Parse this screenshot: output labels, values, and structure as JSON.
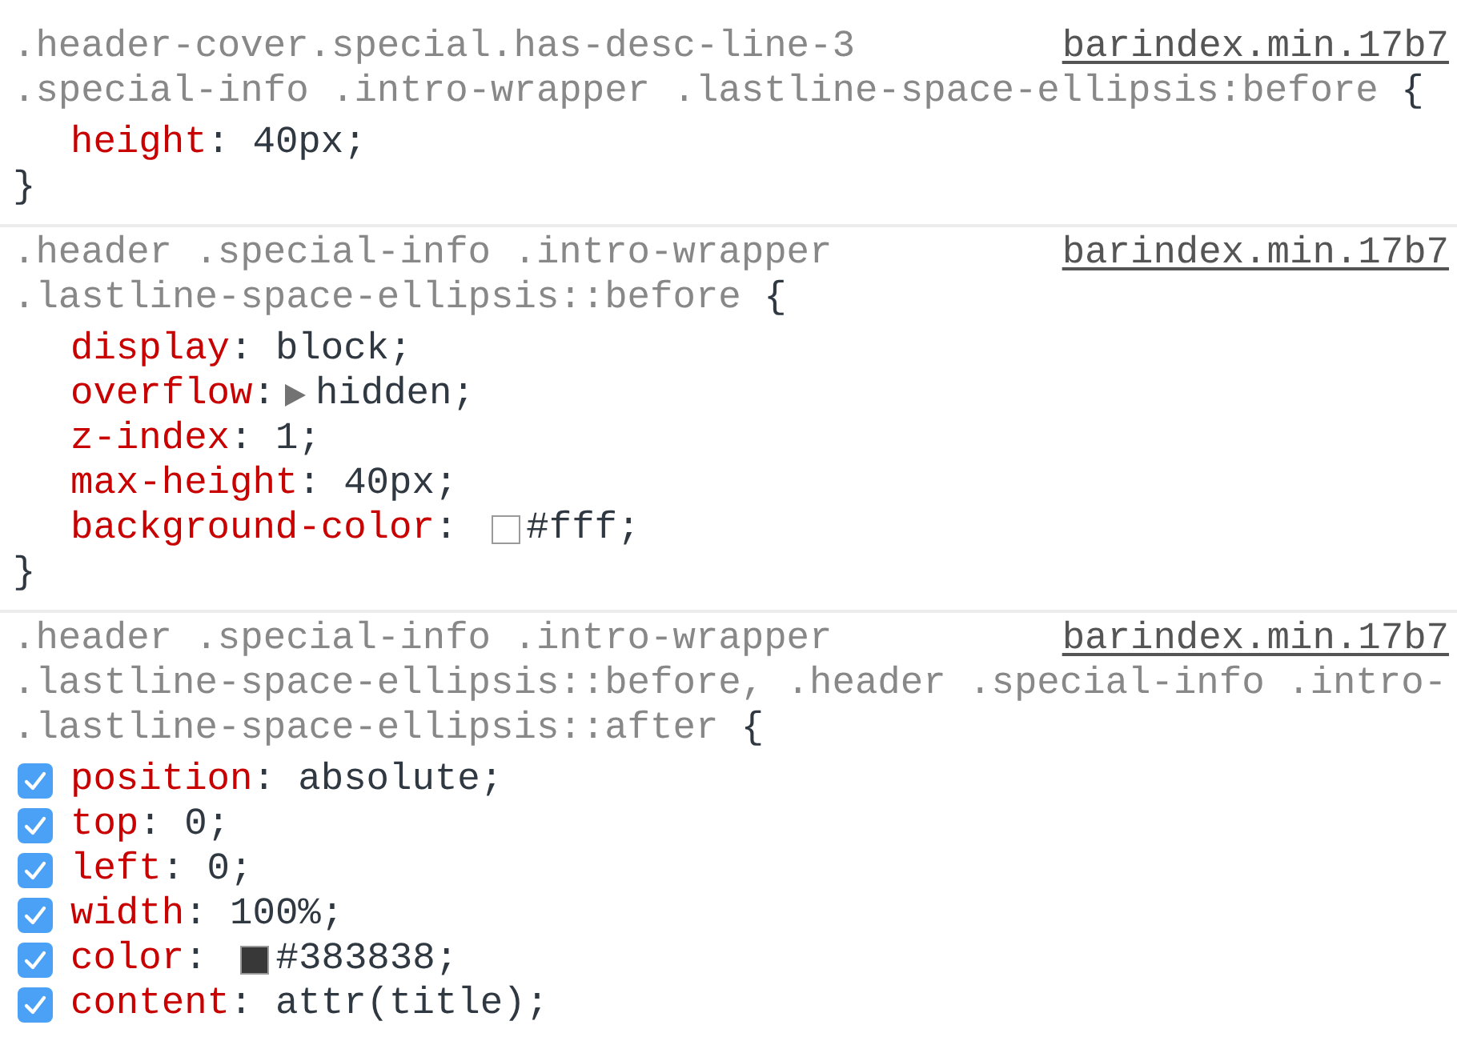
{
  "rules": [
    {
      "selector_lines": [
        {
          "text": ".header-cover.special.has-desc-line-3"
        },
        {
          "text": ".special-info .intro-wrapper .lastline-space-ellipsis:before",
          "brace": "{"
        }
      ],
      "source": "barindex.min.17b7",
      "declarations": [
        {
          "name": "height",
          "colon": ":",
          "expandable": false,
          "value": "40px;"
        }
      ],
      "close_brace": "}"
    },
    {
      "selector_lines": [
        {
          "text": ".header .special-info .intro-wrapper"
        },
        {
          "text": ".lastline-space-ellipsis::before",
          "brace": "{"
        }
      ],
      "source": "barindex.min.17b7",
      "declarations": [
        {
          "name": "display",
          "colon": ":",
          "expandable": false,
          "value": "block;"
        },
        {
          "name": "overflow",
          "colon": ":",
          "expandable": true,
          "value": "hidden;"
        },
        {
          "name": "z-index",
          "colon": ":",
          "expandable": false,
          "value": "1;"
        },
        {
          "name": "max-height",
          "colon": ":",
          "expandable": false,
          "value": "40px;"
        },
        {
          "name": "background-color",
          "colon": ":",
          "expandable": false,
          "color": "#ffffff",
          "value": "#fff;"
        }
      ],
      "close_brace": "}"
    },
    {
      "selector_lines": [
        {
          "text": ".header .special-info .intro-wrapper"
        },
        {
          "text": ".lastline-space-ellipsis::before, .header .special-info .intro-"
        },
        {
          "text": ".lastline-space-ellipsis::after",
          "brace": "{"
        }
      ],
      "source": "barindex.min.17b7",
      "declarations": [
        {
          "name": "position",
          "colon": ":",
          "expandable": false,
          "value": "absolute;",
          "checked": true
        },
        {
          "name": "top",
          "colon": ":",
          "expandable": false,
          "value": "0;",
          "checked": true
        },
        {
          "name": "left",
          "colon": ":",
          "expandable": false,
          "value": "0;",
          "checked": true
        },
        {
          "name": "width",
          "colon": ":",
          "expandable": false,
          "value": "100%;",
          "checked": true
        },
        {
          "name": "color",
          "colon": ":",
          "expandable": false,
          "color": "#383838",
          "value": "#383838;",
          "checked": true
        },
        {
          "name": "content",
          "colon": ":",
          "expandable": false,
          "value": "attr(title);",
          "checked": true
        }
      ]
    }
  ]
}
